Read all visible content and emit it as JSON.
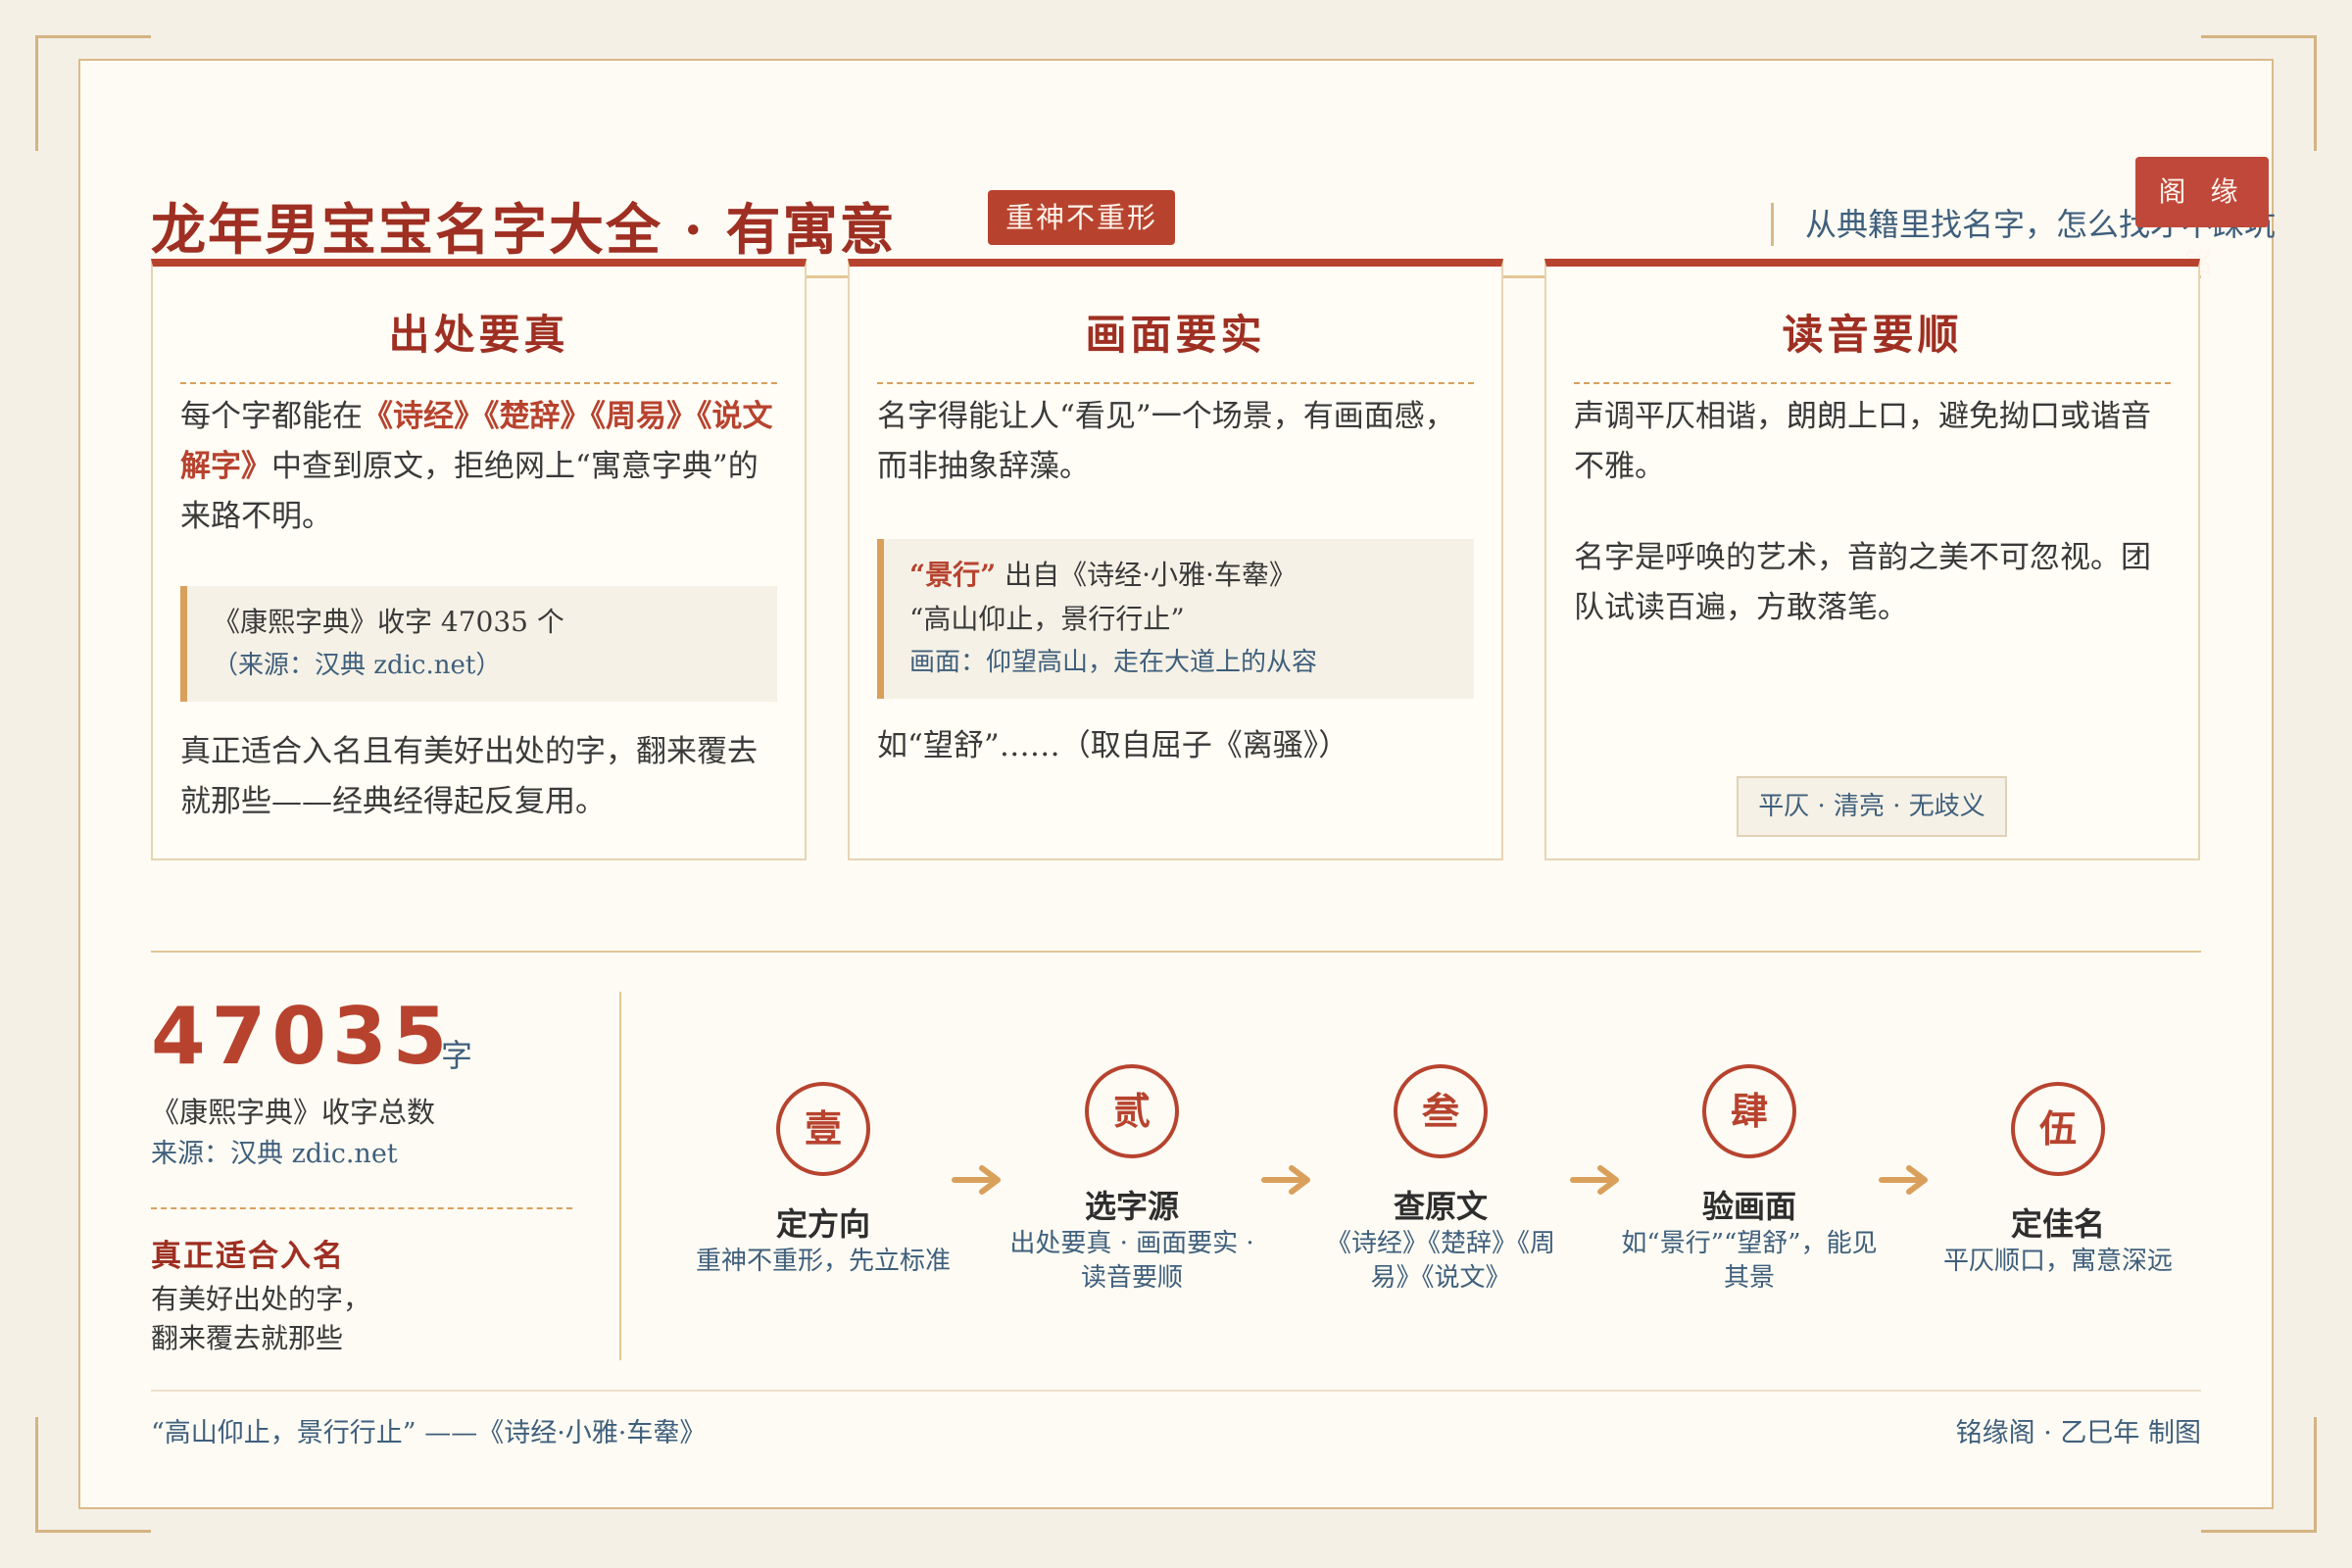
{
  "header": {
    "title": "龙年男宝宝名字大全 · 有寓意",
    "badge": "重神不重形",
    "subtitle": "从典籍里找名字，怎么找才不踩坑",
    "seal": "阁 缘 铭"
  },
  "cards": [
    {
      "title": "出处要真",
      "body_pre": "每个字都能在",
      "body_highlight": "《诗经》《楚辞》《周易》《说文解字》",
      "body_post": "中查到原文，拒绝网上“寓意字典”的来路不明。",
      "quote_line": "《康熙字典》收字 47035 个",
      "quote_source": "（来源：汉典 zdic.net）",
      "after": "真正适合入名且有美好出处的字，翻来覆去就那些——经典经得起反复用。"
    },
    {
      "title": "画面要实",
      "body": "名字得能让人“看见”一个场景，有画面感，而非抽象辞藻。",
      "quote_word": "“景行”",
      "quote_from": " 出自《诗经·小雅·车舝》",
      "quote_text": "“高山仰止，景行行止”",
      "quote_scene": "画面：仰望高山，走在大道上的从容",
      "after": "如“望舒”……（取自屈子《离骚》）"
    },
    {
      "title": "读音要顺",
      "body": "声调平仄相谐，朗朗上口，避免拗口或谐音不雅。",
      "body2": "名字是呼唤的艺术，音韵之美不可忽视。团队试读百遍，方敢落笔。",
      "tag": "平仄 · 清亮 · 无歧义"
    }
  ],
  "stat": {
    "number": "47035",
    "unit": "字",
    "desc": "《康熙字典》收字总数",
    "source": "来源：汉典 zdic.net",
    "head": "真正适合入名",
    "line1": "有美好出处的字，",
    "line2": "翻来覆去就那些"
  },
  "steps": [
    {
      "num": "壹",
      "title": "定方向",
      "desc": "重神不重形，先立标准"
    },
    {
      "num": "贰",
      "title": "选字源",
      "desc": "出处要真 · 画面要实 · 读音要顺"
    },
    {
      "num": "叁",
      "title": "查原文",
      "desc": "《诗经》《楚辞》《周易》《说文》"
    },
    {
      "num": "肆",
      "title": "验画面",
      "desc": "如“景行”“望舒”，能见其景"
    },
    {
      "num": "伍",
      "title": "定佳名",
      "desc": "平仄顺口，寓意深远"
    }
  ],
  "footer": {
    "quote": "“高山仰止，景行行止” ——《诗经·小雅·车舝》",
    "credit": "铭缘阁 · 乙巳年 制图"
  },
  "colors": {
    "accent": "#b7432f",
    "title_red": "#9e2f22",
    "gold": "#d9a05c",
    "blue_text": "#3f5f7c",
    "paper": "#fdfbf3"
  },
  "icons": {
    "arrow": "arrow-right-icon"
  }
}
